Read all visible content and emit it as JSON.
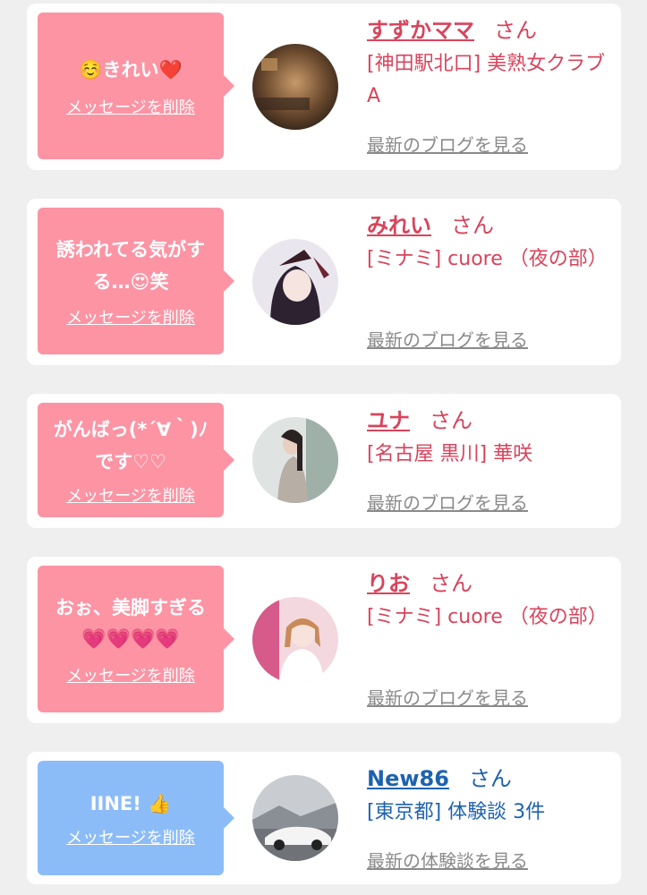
{
  "cards": [
    {
      "message_line1": "☺️きれい❤️",
      "message_line2": "",
      "delete_label": "メッセージを削除",
      "name": "すずかママ",
      "honorific": "さん",
      "shop": "[神田駅北口] 美熟女クラブA",
      "blog_link": "最新のブログを見る",
      "theme": "pink"
    },
    {
      "message_line1": "誘われてる気がす",
      "message_line2": "る…😍笑",
      "delete_label": "メッセージを削除",
      "name": "みれい",
      "honorific": "さん",
      "shop": "[ミナミ] cuore （夜の部）",
      "blog_link": "最新のブログを見る",
      "theme": "pink"
    },
    {
      "message_line1": "がんばっ(*´∀｀)ﾉ",
      "message_line2": "です♡♡",
      "delete_label": "メッセージを削除",
      "name": "ユナ",
      "honorific": "さん",
      "shop": "[名古屋 黒川] 華咲",
      "blog_link": "最新のブログを見る",
      "theme": "pink"
    },
    {
      "message_line1": "おぉ、美脚すぎる",
      "message_line2": "💗💗💗💗",
      "delete_label": "メッセージを削除",
      "name": "りお",
      "honorific": "さん",
      "shop": "[ミナミ] cuore （夜の部）",
      "blog_link": "最新のブログを見る",
      "theme": "pink"
    },
    {
      "message_line1": "IINE! 👍",
      "message_line2": "",
      "delete_label": "メッセージを削除",
      "name": "New86",
      "honorific": "さん",
      "shop": "[東京都] 体験談 3件",
      "blog_link": "最新の体験談を見る",
      "theme": "blue"
    }
  ],
  "colors": {
    "pink_bubble": "#fc94a4",
    "blue_bubble": "#8cbcf8",
    "pink_text": "#d8445c",
    "blue_text": "#1e62b0",
    "link_gray": "#8a8a8a",
    "background": "#efefef"
  }
}
